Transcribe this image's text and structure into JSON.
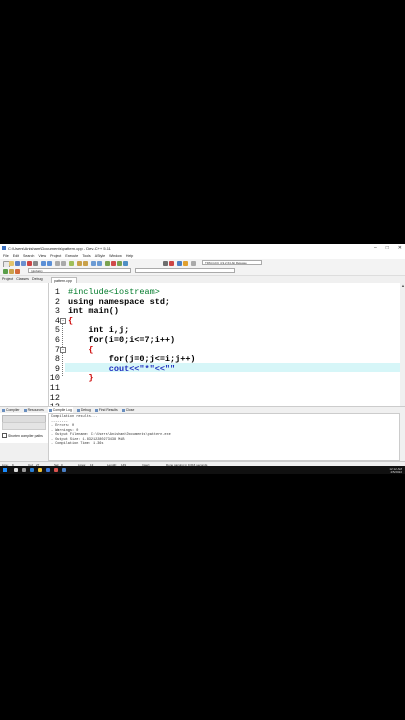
{
  "window": {
    "title": "C:\\Users\\Anisham\\Documents\\pattern.cpp - Dev-C++ 5.11",
    "controls": [
      "–",
      "□",
      "✕"
    ]
  },
  "menu": [
    "File",
    "Edit",
    "Search",
    "View",
    "Project",
    "Execute",
    "Tools",
    "AStyle",
    "Window",
    "Help"
  ],
  "toolbar": {
    "compiler_select": "TDM-GCC 4.9.2 64-bit Release",
    "scope_select": "(globals)"
  },
  "left_panel": {
    "tabs": [
      "Project",
      "Classes",
      "Debug"
    ]
  },
  "editor": {
    "file_tab": "pattern.cpp",
    "lines": [
      {
        "n": "1",
        "text": "#include<iostream>"
      },
      {
        "n": "2",
        "text": "using namespace std;"
      },
      {
        "n": "3",
        "text": "int main()"
      },
      {
        "n": "4",
        "text": "{"
      },
      {
        "n": "5",
        "text": "    int i,j;"
      },
      {
        "n": "6",
        "text": "    for(i=0;i<=7;i++)"
      },
      {
        "n": "7",
        "text": "    {"
      },
      {
        "n": "8",
        "text": "        for(j=0;j<=i;j++)"
      },
      {
        "n": "9",
        "text": "        cout<<\"*\"<<\"\""
      },
      {
        "n": "10",
        "text": "    }"
      },
      {
        "n": "11",
        "text": ""
      },
      {
        "n": "12",
        "text": ""
      },
      {
        "n": "13",
        "text": ""
      }
    ],
    "fold_markers": {
      "4": "−",
      "7": "−"
    }
  },
  "bottom_tabs": [
    "Compiler",
    "Resources",
    "Compile Log",
    "Debug",
    "Find Results",
    "Close"
  ],
  "bottom_panel": {
    "shorten_label": "Shorten compiler paths",
    "log": [
      "Compilation results...",
      "--------",
      "- Errors: 0",
      "- Warnings: 0",
      "- Output Filename: C:\\Users\\Anisham\\Documents\\pattern.exe",
      "- Output Size: 1.83212280273438 MiB",
      "- Compilation Time: 1.36s"
    ]
  },
  "status": {
    "line_label": "Line:",
    "line_val": "9",
    "col_label": "Col:",
    "col_val": "27",
    "sel_label": "Sel:",
    "sel_val": "0",
    "lines_label": "Lines:",
    "lines_val": "13",
    "length_label": "Length:",
    "length_val": "149",
    "mode": "Insert",
    "message": "Done parsing in 0.016 seconds"
  },
  "taskbar": {
    "time": "12:12 AM",
    "date": "4/5/2022"
  }
}
